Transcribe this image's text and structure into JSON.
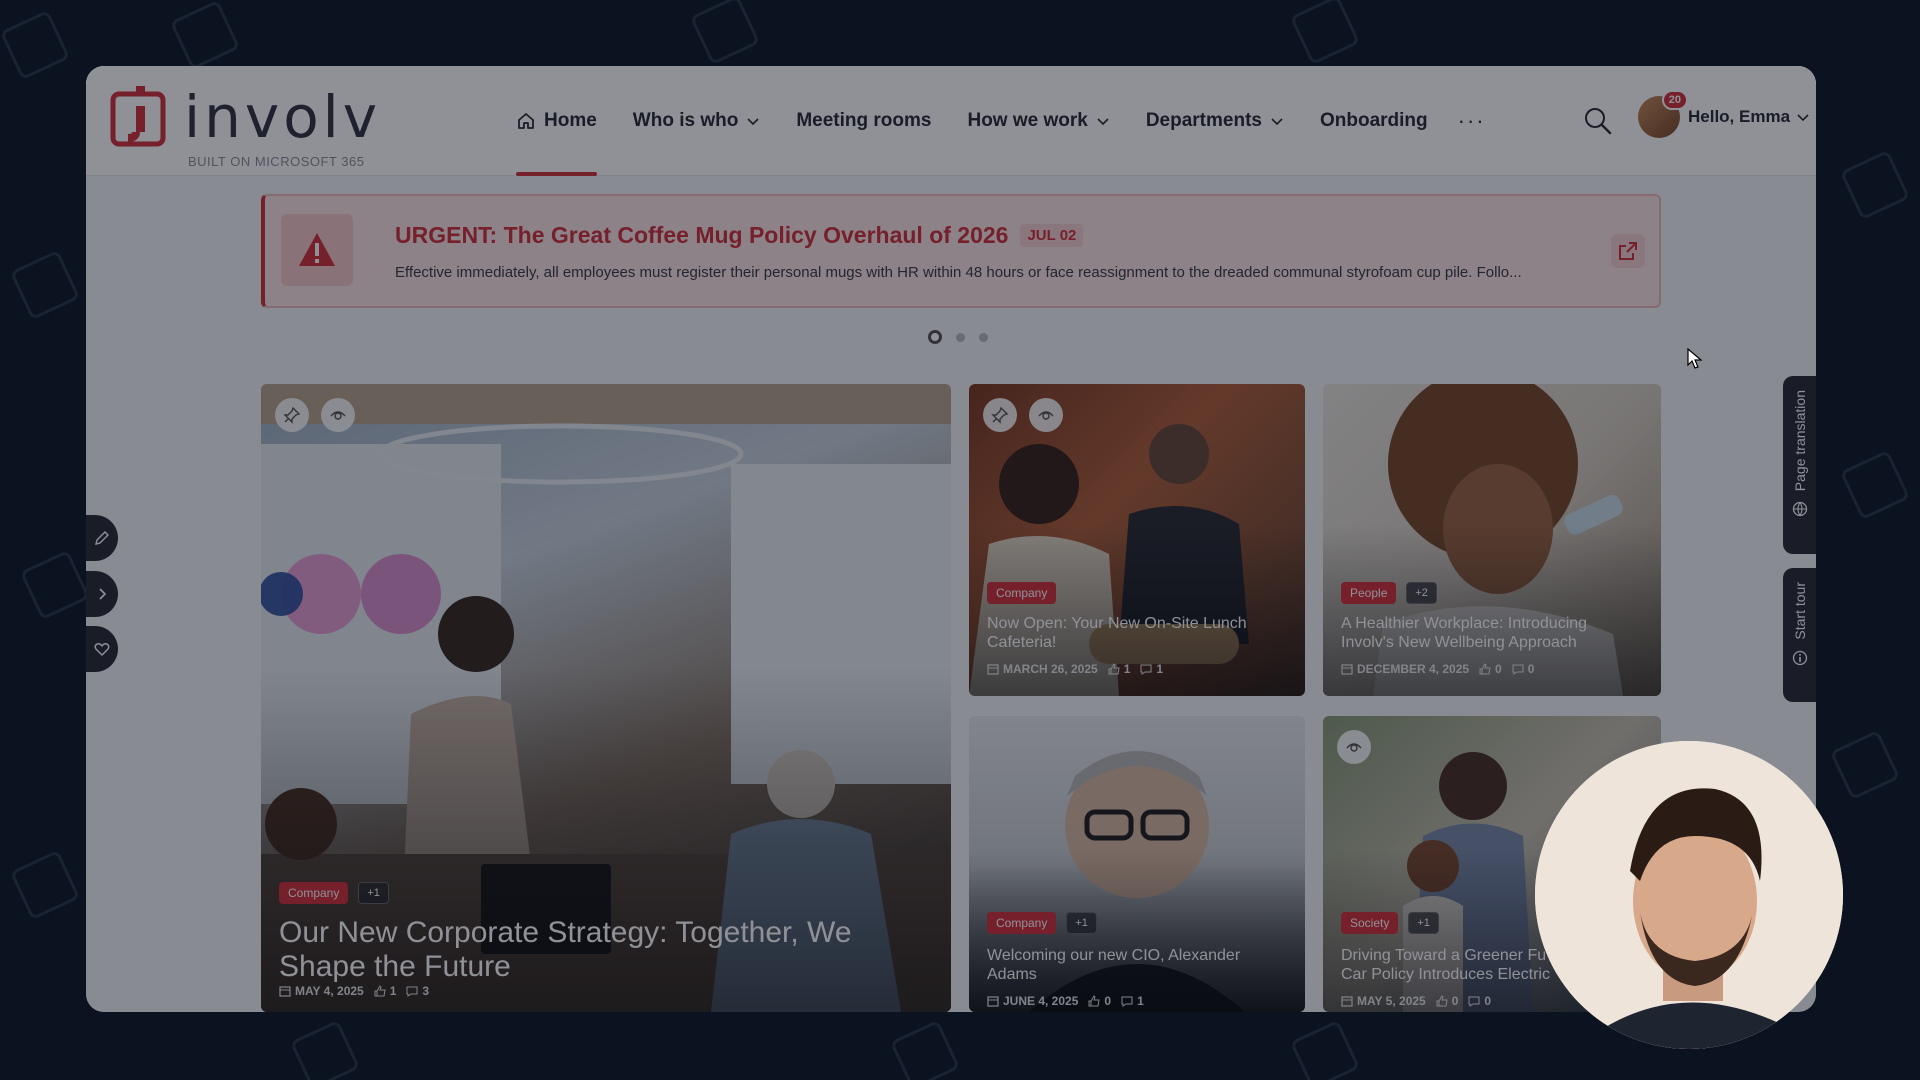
{
  "brand": {
    "name": "involv",
    "tagline": "BUILT ON MICROSOFT 365",
    "accent": "#d0323a"
  },
  "nav": {
    "items": [
      {
        "label": "Home",
        "icon": "home-icon",
        "active": true,
        "dropdown": false
      },
      {
        "label": "Who is who",
        "dropdown": true
      },
      {
        "label": "Meeting rooms",
        "dropdown": false
      },
      {
        "label": "How we work",
        "dropdown": true
      },
      {
        "label": "Departments",
        "dropdown": true
      },
      {
        "label": "Onboarding",
        "dropdown": false
      }
    ],
    "more": "···"
  },
  "user": {
    "greeting": "Hello, Emma",
    "notifications": "20"
  },
  "alert": {
    "title": "URGENT: The Great Coffee Mug Policy Overhaul of 2026",
    "date": "JUL 02",
    "body": "Effective immediately, all employees must register their personal mugs with HR within 48 hours or face reassignment to the dreaded communal styrofoam cup pile. Follo..."
  },
  "carousel": {
    "pages": 3,
    "active": 1
  },
  "news": [
    {
      "tag": "Company",
      "extra": "+1",
      "title": "Our New Corporate Strategy: Together, We Shape the Future",
      "date": "MAY 4, 2025",
      "likes": "1",
      "comments": "3"
    },
    {
      "tag": "Company",
      "extra": "",
      "title": "Now Open: Your New On-Site Lunch Cafeteria!",
      "date": "MARCH 26, 2025",
      "likes": "1",
      "comments": "1"
    },
    {
      "tag": "People",
      "extra": "+2",
      "title": "A Healthier Workplace: Introducing Involv's New Wellbeing Approach",
      "date": "DECEMBER 4, 2025",
      "likes": "0",
      "comments": "0"
    },
    {
      "tag": "Company",
      "extra": "+1",
      "title": "Welcoming our new CIO, Alexander Adams",
      "date": "JUNE 4, 2025",
      "likes": "0",
      "comments": "1"
    },
    {
      "tag": "Society",
      "extra": "+1",
      "title": "Driving Toward a Greener Fu Car Policy Introduces Electric",
      "date": "MAY 5, 2025",
      "likes": "0",
      "comments": "0"
    }
  ],
  "sidetabs": {
    "translation": "Page translation",
    "tour": "Start tour"
  }
}
